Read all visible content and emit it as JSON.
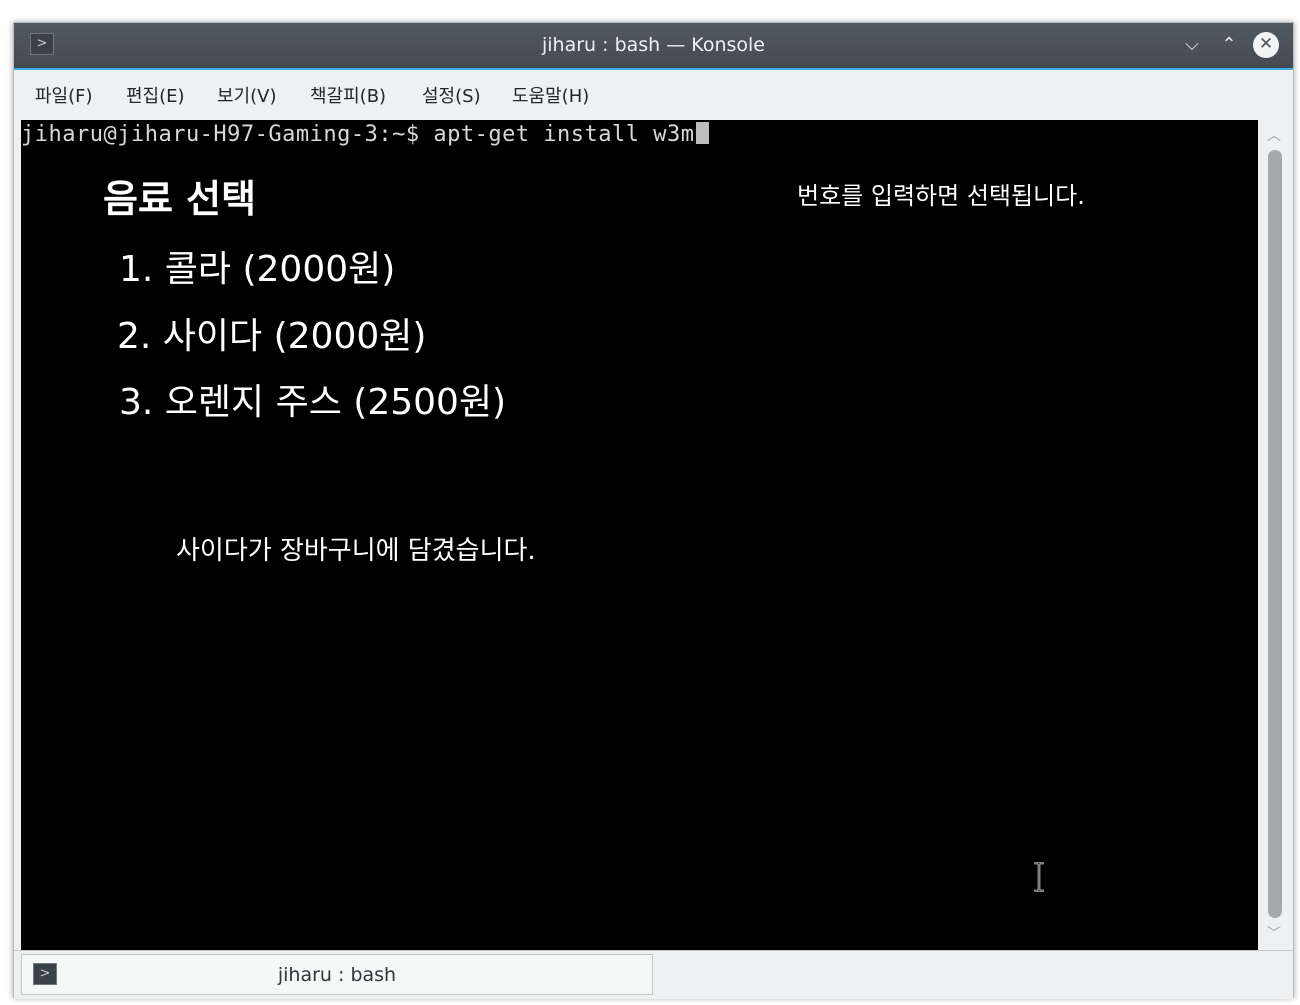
{
  "window": {
    "title": "jiharu : bash — Konsole",
    "controls": {
      "minimize": "⌵",
      "maximize": "⌃",
      "close": "✕"
    }
  },
  "menu": {
    "items": [
      "파일(F)",
      "편집(E)",
      "보기(V)",
      "책갈피(B)",
      "설정(S)",
      "도움말(H)"
    ]
  },
  "terminal": {
    "prompt": "jiharu@jiharu-H97-Gaming-3:~$ apt-get install w3m",
    "heading": "음료 선택",
    "hint": "번호를 입력하면 선택됩니다.",
    "options": [
      "1. 콜라 (2000원)",
      "2. 사이다 (2000원)",
      "3. 오렌지 주스 (2500원)"
    ],
    "message": "사이다가 장바구니에 담겼습니다."
  },
  "tabs": [
    {
      "label": "jiharu : bash"
    }
  ],
  "icons": {
    "app": "terminal-icon",
    "tab": "terminal-icon"
  },
  "colors": {
    "accent": "#3daee9",
    "titlebar": "#4a5157",
    "terminal_bg": "#000000",
    "terminal_fg": "#ffffff"
  }
}
